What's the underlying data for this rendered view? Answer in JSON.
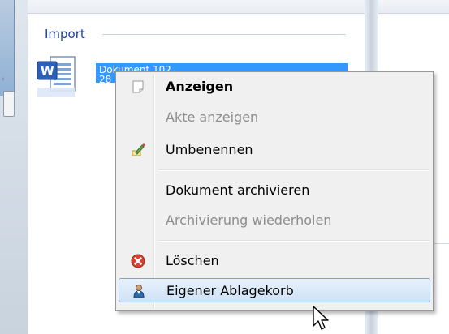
{
  "section": {
    "title": "Import"
  },
  "document": {
    "icon": "word-document-icon",
    "name_line1": "Dokument 102",
    "name_line2": "28"
  },
  "context_menu": {
    "items": [
      {
        "label": "Anzeigen",
        "bold": true,
        "disabled": false,
        "icon": "blank-page-icon"
      },
      {
        "label": "Akte anzeigen",
        "bold": false,
        "disabled": true,
        "icon": ""
      },
      {
        "label": "Umbenennen",
        "bold": false,
        "disabled": false,
        "icon": "rename-pen-icon"
      },
      {
        "label": "Dokument archivieren",
        "bold": false,
        "disabled": false,
        "icon": ""
      },
      {
        "label": "Archivierung wiederholen",
        "bold": false,
        "disabled": true,
        "icon": ""
      },
      {
        "label": "Löschen",
        "bold": false,
        "disabled": false,
        "icon": "delete-red-icon"
      },
      {
        "label": "Eigener Ablagekorb",
        "bold": false,
        "disabled": false,
        "icon": "user-icon",
        "hovered": true
      }
    ]
  },
  "colors": {
    "selection": "#3399ff",
    "section_title": "#1d3d9a",
    "menu_bg": "#f0f0f0",
    "hover_border": "#7da2ce"
  }
}
